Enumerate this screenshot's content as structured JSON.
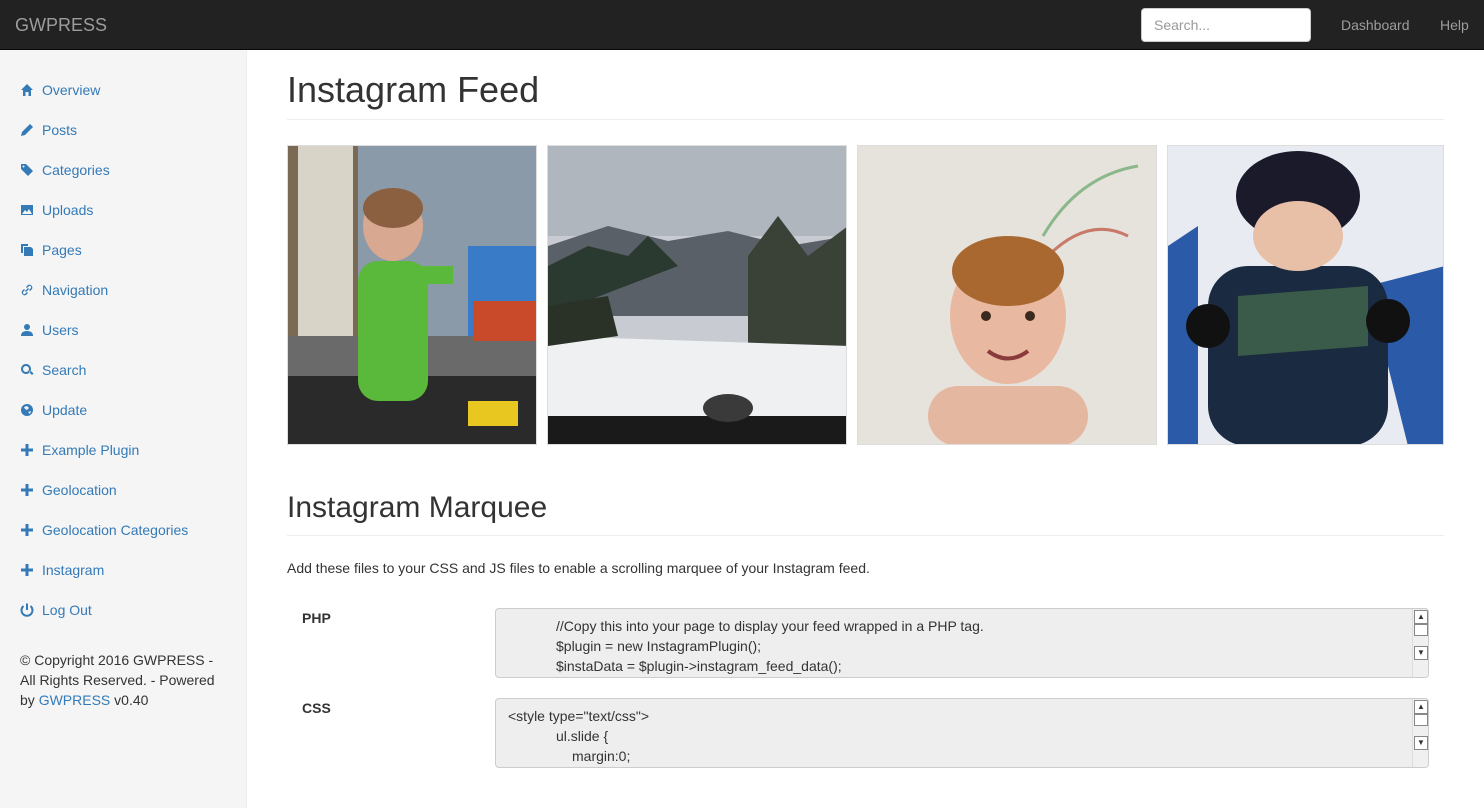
{
  "navbar": {
    "brand": "GWPRESS",
    "search_placeholder": "Search...",
    "links": [
      "Dashboard",
      "Help"
    ]
  },
  "sidebar": {
    "items": [
      {
        "label": "Overview",
        "icon": "home-icon"
      },
      {
        "label": "Posts",
        "icon": "pencil-icon"
      },
      {
        "label": "Categories",
        "icon": "tags-icon"
      },
      {
        "label": "Uploads",
        "icon": "picture-icon"
      },
      {
        "label": "Pages",
        "icon": "duplicate-icon"
      },
      {
        "label": "Navigation",
        "icon": "link-icon"
      },
      {
        "label": "Users",
        "icon": "user-icon"
      },
      {
        "label": "Search",
        "icon": "search-icon"
      },
      {
        "label": "Update",
        "icon": "globe-icon"
      },
      {
        "label": "Example Plugin",
        "icon": "plus-icon"
      },
      {
        "label": "Geolocation",
        "icon": "plus-icon"
      },
      {
        "label": "Geolocation Categories",
        "icon": "plus-icon"
      },
      {
        "label": "Instagram",
        "icon": "plus-icon"
      },
      {
        "label": "Log Out",
        "icon": "power-icon"
      }
    ],
    "copyright_prefix": "© Copyright 2016 GWPRESS - All Rights Reserved. - Powered by",
    "copyright_link": "GWPRESS",
    "copyright_version": "v0.40"
  },
  "main": {
    "title": "Instagram Feed",
    "marquee_title": "Instagram Marquee",
    "marquee_desc": "Add these files to your CSS and JS files to enable a scrolling marquee of your Instagram feed.",
    "php": {
      "label": "PHP",
      "lines": [
        "//Copy this into your page to display your feed wrapped in a PHP tag.",
        "$plugin = new InstagramPlugin();",
        "$instaData = $plugin->instagram_feed_data();"
      ]
    },
    "css": {
      "label": "CSS",
      "lines": [
        "<style type=\"text/css\">",
        "ul.slide {",
        "margin:0;"
      ]
    }
  }
}
